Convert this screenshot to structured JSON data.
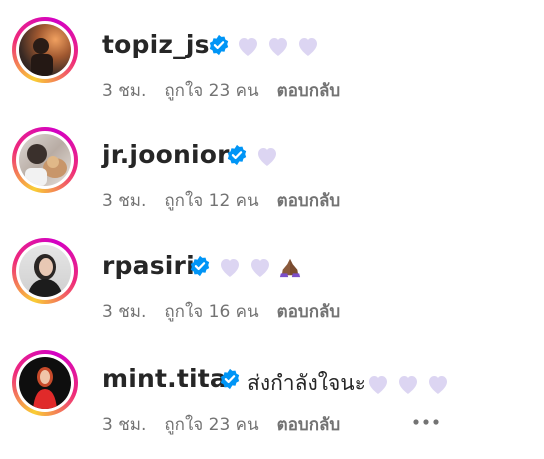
{
  "heart_color": "#d8d2f0",
  "verified_color": "#0095f6",
  "comments": [
    {
      "username": "topiz_js",
      "text": "",
      "hearts": 3,
      "time": "3 ชม.",
      "likes": "ถูกใจ 23 คน",
      "reply": "ตอบกลับ"
    },
    {
      "username": "jr.joonior",
      "text": "",
      "hearts": 1,
      "time": "3 ชม.",
      "likes": "ถูกใจ 12 คน",
      "reply": "ตอบกลับ"
    },
    {
      "username": "rpasiri",
      "text": "",
      "hearts": 2,
      "extra_emoji": "🙏🏽",
      "time": "3 ชม.",
      "likes": "ถูกใจ 16 คน",
      "reply": "ตอบกลับ"
    },
    {
      "username": "mint.tita",
      "text": "ส่งกำลังใจนะ",
      "hearts": 3,
      "time": "3 ชม.",
      "likes": "ถูกใจ 23 คน",
      "reply": "ตอบกลับ",
      "more_icon": "ellipsis-icon"
    }
  ]
}
